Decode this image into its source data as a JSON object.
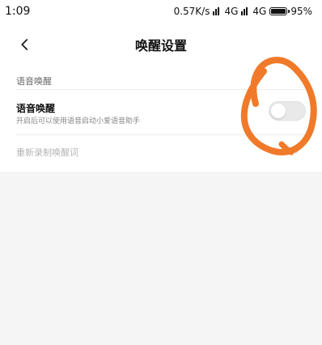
{
  "status_bar": {
    "time": "1:09",
    "speed": "0.57K/s",
    "network1": "4G",
    "network2": "4G",
    "battery_percent": "95%"
  },
  "header": {
    "back_icon": "chevron-left-icon",
    "title": "唤醒设置"
  },
  "settings": {
    "section_title": "语音唤醒",
    "voice_wake": {
      "label": "语音唤醒",
      "description": "开启后可以使用语音启动小爱语音助手",
      "enabled": false
    },
    "rerecord": {
      "label": "重新录制唤醒词",
      "disabled": true
    }
  },
  "annotation": {
    "color": "#f07a2a"
  }
}
